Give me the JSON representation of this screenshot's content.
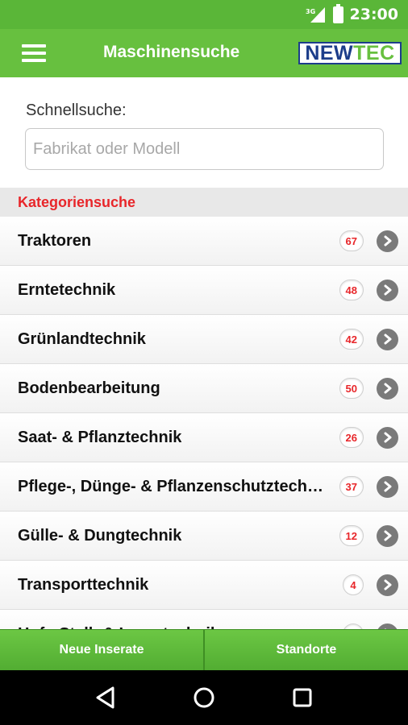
{
  "status": {
    "time": "23:00",
    "network": "3G"
  },
  "appbar": {
    "title": "Maschinensuche",
    "logo_new": "NEW",
    "logo_tec": "TEC"
  },
  "search": {
    "label": "Schnellsuche:",
    "placeholder": "Fabrikat oder Modell",
    "value": ""
  },
  "categories": {
    "header": "Kategoriensuche",
    "items": [
      {
        "label": "Traktoren",
        "count": "67"
      },
      {
        "label": "Erntetechnik",
        "count": "48"
      },
      {
        "label": "Grünlandtechnik",
        "count": "42"
      },
      {
        "label": "Bodenbearbeitung",
        "count": "50"
      },
      {
        "label": "Saat- & Pflanztechnik",
        "count": "26"
      },
      {
        "label": "Pflege-, Dünge- & Pflanzenschutztechnik",
        "count": "37"
      },
      {
        "label": "Gülle- & Dungtechnik",
        "count": "12"
      },
      {
        "label": "Transporttechnik",
        "count": "4"
      },
      {
        "label": "Hof-, Stall- & Lagertechnik",
        "count": ""
      }
    ]
  },
  "bottom_tabs": {
    "new_listings": "Neue Inserate",
    "locations": "Standorte"
  },
  "colors": {
    "primary": "#67c03f",
    "accent": "#e8262a",
    "logo_blue": "#1c3d8a"
  },
  "icons": {
    "menu": "hamburger-icon",
    "chevron": "chevron-right-icon",
    "back": "back-triangle-icon",
    "home": "home-circle-icon",
    "recents": "recents-square-icon"
  }
}
